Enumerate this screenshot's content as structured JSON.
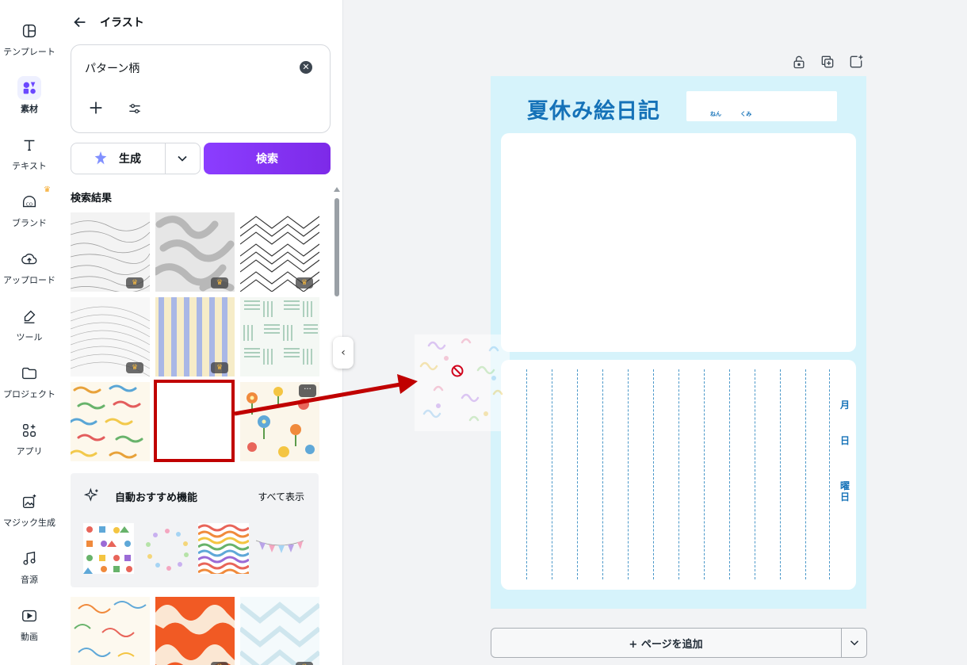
{
  "rail": {
    "items": [
      {
        "label": "テンプレート",
        "icon": "template-icon"
      },
      {
        "label": "素材",
        "icon": "elements-icon",
        "active": true
      },
      {
        "label": "テキスト",
        "icon": "text-icon"
      },
      {
        "label": "ブランド",
        "icon": "brand-icon"
      },
      {
        "label": "アップロード",
        "icon": "upload-icon"
      },
      {
        "label": "ツール",
        "icon": "tools-icon"
      },
      {
        "label": "プロジェクト",
        "icon": "folder-icon"
      },
      {
        "label": "アプリ",
        "icon": "apps-icon"
      },
      {
        "label": "マジック生成",
        "icon": "magic-media-icon"
      },
      {
        "label": "音源",
        "icon": "music-icon"
      },
      {
        "label": "動画",
        "icon": "video-icon"
      }
    ]
  },
  "panel": {
    "title": "イラスト",
    "search": {
      "query": "パターン柄"
    },
    "generate_label": "生成",
    "search_label": "検索",
    "results_label": "検索結果",
    "recommend": {
      "title": "自動おすすめ機能",
      "show_all": "すべて表示"
    }
  },
  "page": {
    "title": "夏休み絵日記",
    "name_labels": [
      "ねん",
      "くみ"
    ],
    "date_labels": [
      "月",
      "日",
      "曜日"
    ]
  },
  "add_page_label": "+ ページを追加",
  "colors": {
    "accent": "#8b3dff",
    "page_bg": "#d6f3fb",
    "title_blue": "#1572b8",
    "highlight_red": "#c00000"
  }
}
